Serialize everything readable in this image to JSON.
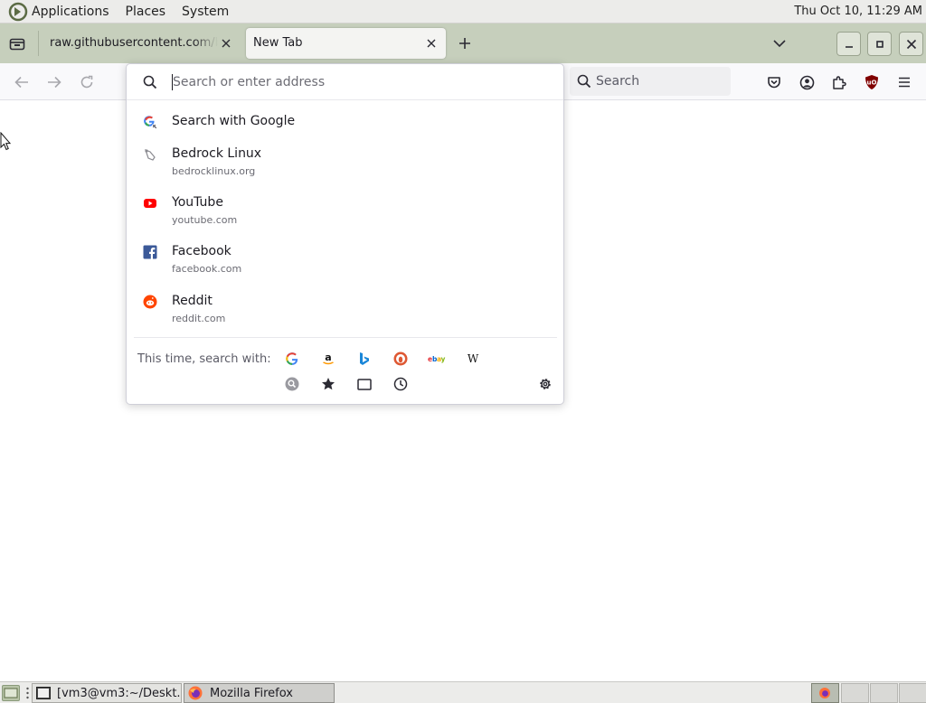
{
  "top_panel": {
    "applications_label": "Applications",
    "places_label": "Places",
    "system_label": "System",
    "clock": "Thu Oct 10, 11:29 AM"
  },
  "tabs": [
    {
      "title": "raw.githubusercontent.com/bedrocklinux",
      "active": false
    },
    {
      "title": "New Tab",
      "active": true
    }
  ],
  "toolbar": {
    "search_placeholder": "Search"
  },
  "urlbar": {
    "placeholder": "Search or enter address",
    "value": ""
  },
  "results": [
    {
      "title": "Search with Google",
      "url": "",
      "icon": "google-search-icon"
    },
    {
      "title": "Bedrock Linux",
      "url": "bedrocklinux.org",
      "icon": "bedrock-favicon"
    },
    {
      "title": "YouTube",
      "url": "youtube.com",
      "icon": "youtube-icon"
    },
    {
      "title": "Facebook",
      "url": "facebook.com",
      "icon": "facebook-icon"
    },
    {
      "title": "Reddit",
      "url": "reddit.com",
      "icon": "reddit-icon"
    }
  ],
  "one_off": {
    "label": "This time, search with:",
    "engines": [
      "Google",
      "Amazon",
      "Bing",
      "DuckDuckGo",
      "eBay",
      "Wikipedia"
    ],
    "modes": [
      "Search",
      "Bookmarks",
      "Tabs",
      "History"
    ]
  },
  "taskbar": {
    "tasks": [
      {
        "label": "[vm3@vm3:~/Deskt...",
        "icon": "terminal-icon"
      },
      {
        "label": "Mozilla Firefox",
        "icon": "firefox-icon"
      }
    ],
    "workspaces": 4,
    "active_workspace": 1
  },
  "colors": {
    "tabstrip": "#c6cfbc",
    "youtube": "#ff0000",
    "facebook": "#1877f2",
    "reddit": "#ff4500",
    "ublock": "#800000"
  }
}
